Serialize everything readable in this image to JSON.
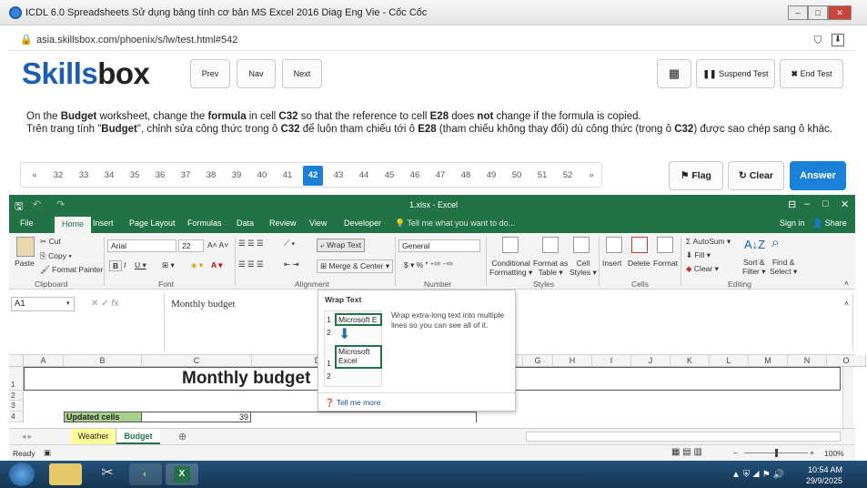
{
  "browser": {
    "window_title": "ICDL 6.0 Spreadsheets Sử dụng bảng tính cơ bản MS Excel 2016 Diag Eng Vie - Cốc Cốc",
    "url": "asia.skillsbox.com/phoenix/s/lw/test.html#542"
  },
  "skillsbox": {
    "logo_part1": "Skills",
    "logo_part2": "box",
    "prev_label": "Prev",
    "nav_label": "Nav",
    "next_label": "Next",
    "calculator_icon": "calculator-icon",
    "suspend_label": "Suspend Test",
    "end_label": "End Test",
    "question_en": "On the Budget worksheet, change the formula in cell C32 so that the reference to cell E28 does not change if the formula is copied.",
    "question_vi": "Trên trang tính \"Budget\", chỉnh sửa công thức trong ô C32 để luôn tham chiếu tới ô E28 (tham chiếu không thay đổi) dù công thức (trong ô C32) được sao chép sang ô khác.",
    "pager_prev": "«",
    "pager_next": "»",
    "pages": [
      "32",
      "33",
      "34",
      "35",
      "36",
      "37",
      "38",
      "39",
      "40",
      "41",
      "42",
      "43",
      "44",
      "45",
      "46",
      "47",
      "48",
      "49",
      "50",
      "51",
      "52"
    ],
    "active_page": "42",
    "flag_label": "Flag",
    "clear_label": "Clear",
    "answer_label": "Answer"
  },
  "excel": {
    "title": "1.xlsx - Excel",
    "tabs": [
      "File",
      "Home",
      "Insert",
      "Page Layout",
      "Formulas",
      "Data",
      "Review",
      "View",
      "Developer"
    ],
    "active_tab": "Home",
    "tell_me": "Tell me what you want to do...",
    "sign_in": "Sign in",
    "share": "Share",
    "ribbon": {
      "paste": "Paste",
      "cut": "Cut",
      "copy": "Copy",
      "format_painter": "Format Painter",
      "clipboard": "Clipboard",
      "font_name": "Arial",
      "font_size": "22",
      "font_group": "Font",
      "wrap_text": "Wrap Text",
      "merge_center": "Merge & Center",
      "alignment": "Alignment",
      "number_format": "General",
      "number": "Number",
      "conditional": "Conditional",
      "formatting": "Formatting",
      "format_as": "Format as",
      "table": "Table",
      "cell": "Cell",
      "styles_btn": "Styles",
      "styles": "Styles",
      "insert": "Insert",
      "delete": "Delete",
      "format": "Format",
      "cells": "Cells",
      "autosum": "AutoSum",
      "fill": "Fill",
      "clear": "Clear",
      "sort": "Sort &",
      "filter": "Filter",
      "find": "Find &",
      "select": "Select",
      "editing": "Editing"
    },
    "name_box": "A1",
    "formula": "Monthly budget",
    "columns": [
      "A",
      "B",
      "C",
      "D",
      "E",
      "F",
      "G",
      "H",
      "I",
      "J",
      "K",
      "L",
      "M",
      "N",
      "O"
    ],
    "rows": [
      "1",
      "2",
      "3",
      "4"
    ],
    "cell_title": "Monthly budget",
    "cell_b4": "Updated cells",
    "cell_c4": "39",
    "tooltip": {
      "title": "Wrap Text",
      "desc": "Wrap extra-long text into multiple lines so you can see all of it.",
      "ex1": "Microsoft E",
      "ex2a": "Microsoft",
      "ex2b": "Excel",
      "r1": "1",
      "r2": "2",
      "tell_more": "Tell me more"
    },
    "sheets": [
      "Weather",
      "Budget"
    ],
    "active_sheet": "Budget",
    "status": "Ready",
    "zoom": "100%"
  },
  "taskbar": {
    "time": "10:54 AM",
    "date": "29/9/2025"
  }
}
